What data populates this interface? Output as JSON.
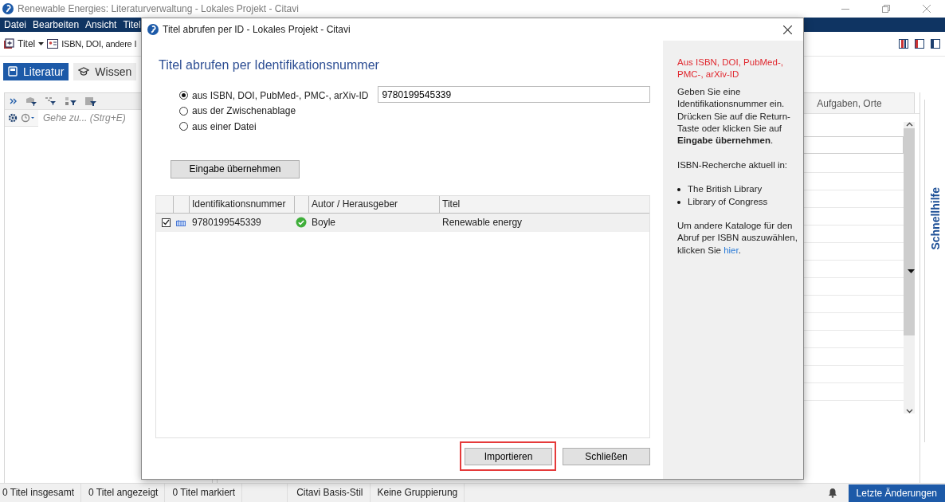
{
  "window": {
    "title": "Renewable Energies: Literaturverwaltung - Lokales Projekt - Citavi"
  },
  "menu": [
    "Datei",
    "Bearbeiten",
    "Ansicht",
    "Titel"
  ],
  "toolbar": [
    {
      "label": "Titel",
      "kind": "dropdown"
    },
    {
      "label": "ISBN, DOI, andere I",
      "kind": "button"
    }
  ],
  "nav_tabs": [
    {
      "label": "Literatur",
      "selected": true
    },
    {
      "label": "Wissen",
      "selected": false
    }
  ],
  "left_panel": {
    "search": {
      "placeholder": "Gehe zu... (Strg+E)"
    }
  },
  "right_panel": {
    "tab": "Aufgaben, Orte"
  },
  "side_panel": {
    "label": "Schnellhilfe"
  },
  "status_bar": {
    "items": [
      "0 Titel insgesamt",
      "0 Titel angezeigt",
      "0 Titel markiert",
      "Citavi Basis-Stil",
      "Keine Gruppierung"
    ],
    "button": "Letzte Änderungen"
  },
  "dialog": {
    "title": "Titel abrufen per ID - Lokales Projekt - Citavi",
    "heading": "Titel abrufen per Identifikationsnummer",
    "sources": [
      {
        "label": "aus ISBN, DOI, PubMed-, PMC-, arXiv-ID",
        "selected": true
      },
      {
        "label": "aus der Zwischenablage",
        "selected": false
      },
      {
        "label": "aus einer Datei",
        "selected": false
      }
    ],
    "id_value": "9780199545339",
    "apply_button": "Eingabe übernehmen",
    "table": {
      "columns": [
        "Identifikationsnummer",
        "Autor / Herausgeber",
        "Titel"
      ],
      "rows": [
        {
          "checked": true,
          "id": "9780199545339",
          "author": "Boyle",
          "title": "Renewable energy"
        }
      ]
    },
    "buttons": [
      {
        "label": "Importieren",
        "highlighted": true
      },
      {
        "label": "Schließen",
        "highlighted": false
      }
    ],
    "help": {
      "heading": "Aus ISBN, DOI, PubMed-, PMC-, arXiv-ID",
      "intro": "Geben Sie eine Identifikationsnummer ein. Drücken Sie auf die Return-Taste oder klicken Sie auf **Eingabe übernehmen**.",
      "catalogs_label": "ISBN-Recherche aktuell in:",
      "catalogs": [
        "The British Library",
        "Library of Congress"
      ],
      "footer": "Um andere Kataloge für den Abruf per ISBN auszuwählen, klicken Sie",
      "link": "hier",
      "footer_end": "."
    }
  }
}
